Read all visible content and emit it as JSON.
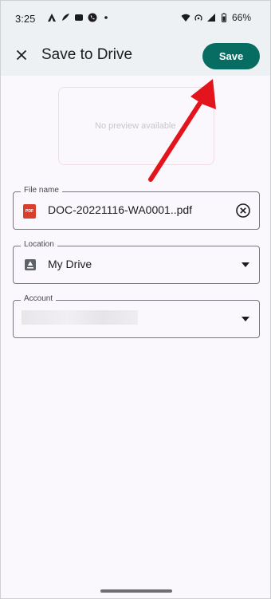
{
  "status_bar": {
    "time": "3:25",
    "battery": "66%",
    "icons_left": [
      "autocad-icon",
      "feather-icon",
      "app-icon",
      "phone-icon",
      "dot-icon"
    ],
    "icons_right": [
      "wifi-icon",
      "hotspot-icon",
      "signal-icon",
      "battery-icon"
    ]
  },
  "header": {
    "title": "Save to Drive",
    "close_icon": "close-icon",
    "save_label": "Save"
  },
  "preview": {
    "placeholder": "No preview available"
  },
  "fields": {
    "file_name": {
      "label": "File name",
      "value": "DOC-20221116-WA0001..pdf",
      "icon": "pdf-icon",
      "icon_text": "PDF",
      "clear_icon": "clear-icon"
    },
    "location": {
      "label": "Location",
      "value": "My Drive",
      "icon": "drive-icon",
      "dropdown_icon": "chevron-down-icon"
    },
    "account": {
      "label": "Account",
      "value": "",
      "dropdown_icon": "chevron-down-icon"
    }
  },
  "colors": {
    "accent": "#076d62",
    "arrow": "#e3141c",
    "header_bg": "#eef1f4",
    "page_bg": "#fbf8fd"
  }
}
